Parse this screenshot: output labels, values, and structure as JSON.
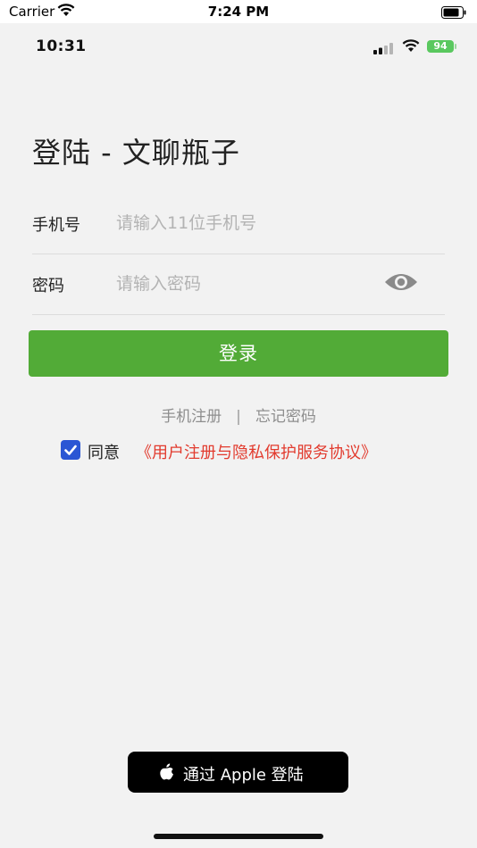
{
  "outer_status": {
    "carrier": "Carrier",
    "time": "7:24 PM"
  },
  "inner_status": {
    "time": "10:31",
    "battery": "94"
  },
  "title": "登陆 - 文聊瓶子",
  "phone_field": {
    "label": "手机号",
    "placeholder": "请输入11位手机号"
  },
  "password_field": {
    "label": "密码",
    "placeholder": "请输入密码"
  },
  "login_button": "登录",
  "links": {
    "register": "手机注册",
    "separator": "|",
    "forgot": "忘记密码"
  },
  "agreement": {
    "checked": true,
    "label": "同意",
    "link": "《用户注册与隐私保护服务协议》"
  },
  "apple_login": "通过 Apple 登陆",
  "colors": {
    "accent": "#52ab37",
    "checkbox": "#2b56d4",
    "link_red": "#e23b2e"
  },
  "icons": [
    "wifi-icon",
    "battery-icon",
    "signal-icon",
    "eye-icon",
    "check-icon",
    "apple-icon"
  ]
}
